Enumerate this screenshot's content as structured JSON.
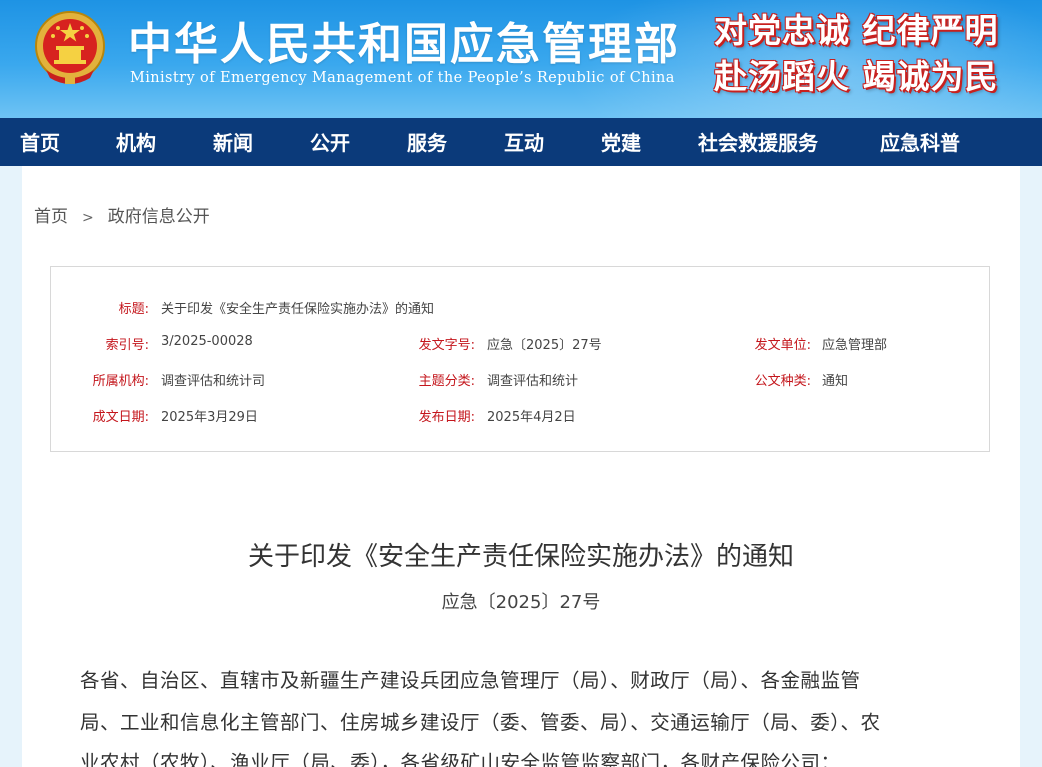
{
  "header": {
    "title": "中华人民共和国应急管理部",
    "subtitle": "Ministry of Emergency Management of the People’s Republic of China",
    "slogan_line1": "对党忠诚 纪律严明",
    "slogan_line2": "赴汤蹈火 竭诚为民",
    "emblem_icon": "national-emblem-icon"
  },
  "nav": {
    "items": [
      {
        "label": "首页"
      },
      {
        "label": "机构"
      },
      {
        "label": "新闻"
      },
      {
        "label": "公开"
      },
      {
        "label": "服务"
      },
      {
        "label": "互动"
      },
      {
        "label": "党建"
      },
      {
        "label": "社会救援服务"
      },
      {
        "label": "应急科普"
      }
    ]
  },
  "breadcrumb": {
    "home": "首页",
    "separator": ">",
    "current": "政府信息公开"
  },
  "meta": {
    "title_label": "标题:",
    "title_value": "关于印发《安全生产责任保险实施办法》的通知",
    "index_label": "索引号:",
    "index_value": "3/2025-00028",
    "docno_label": "发文字号:",
    "docno_value": "应急〔2025〕27号",
    "issuer_label": "发文单位:",
    "issuer_value": "应急管理部",
    "org_label": "所属机构:",
    "org_value": "调查评估和统计司",
    "topic_label": "主题分类:",
    "topic_value": "调查评估和统计",
    "type_label": "公文种类:",
    "type_value": "通知",
    "created_label": "成文日期:",
    "created_value": "2025年3月29日",
    "published_label": "发布日期:",
    "published_value": "2025年4月2日"
  },
  "document": {
    "title": "关于印发《安全生产责任保险实施办法》的通知",
    "number": "应急〔2025〕27号",
    "body_lines": [
      "各省、自治区、直辖市及新疆生产建设兵团应急管理厅（局）、财政厅（局）、各金融监管",
      "局、工业和信息化主管部门、住房城乡建设厅（委、管委、局）、交通运输厅（局、委）、农",
      "业农村（农牧）、渔业厅（局、委），各省级矿山安全监管监察部门，各财产保险公司："
    ]
  },
  "colors": {
    "header_blue": "#1e93e4",
    "nav_bg": "#0b3a7a",
    "label_red": "#c4161c",
    "page_bg": "#e6f3fb"
  }
}
